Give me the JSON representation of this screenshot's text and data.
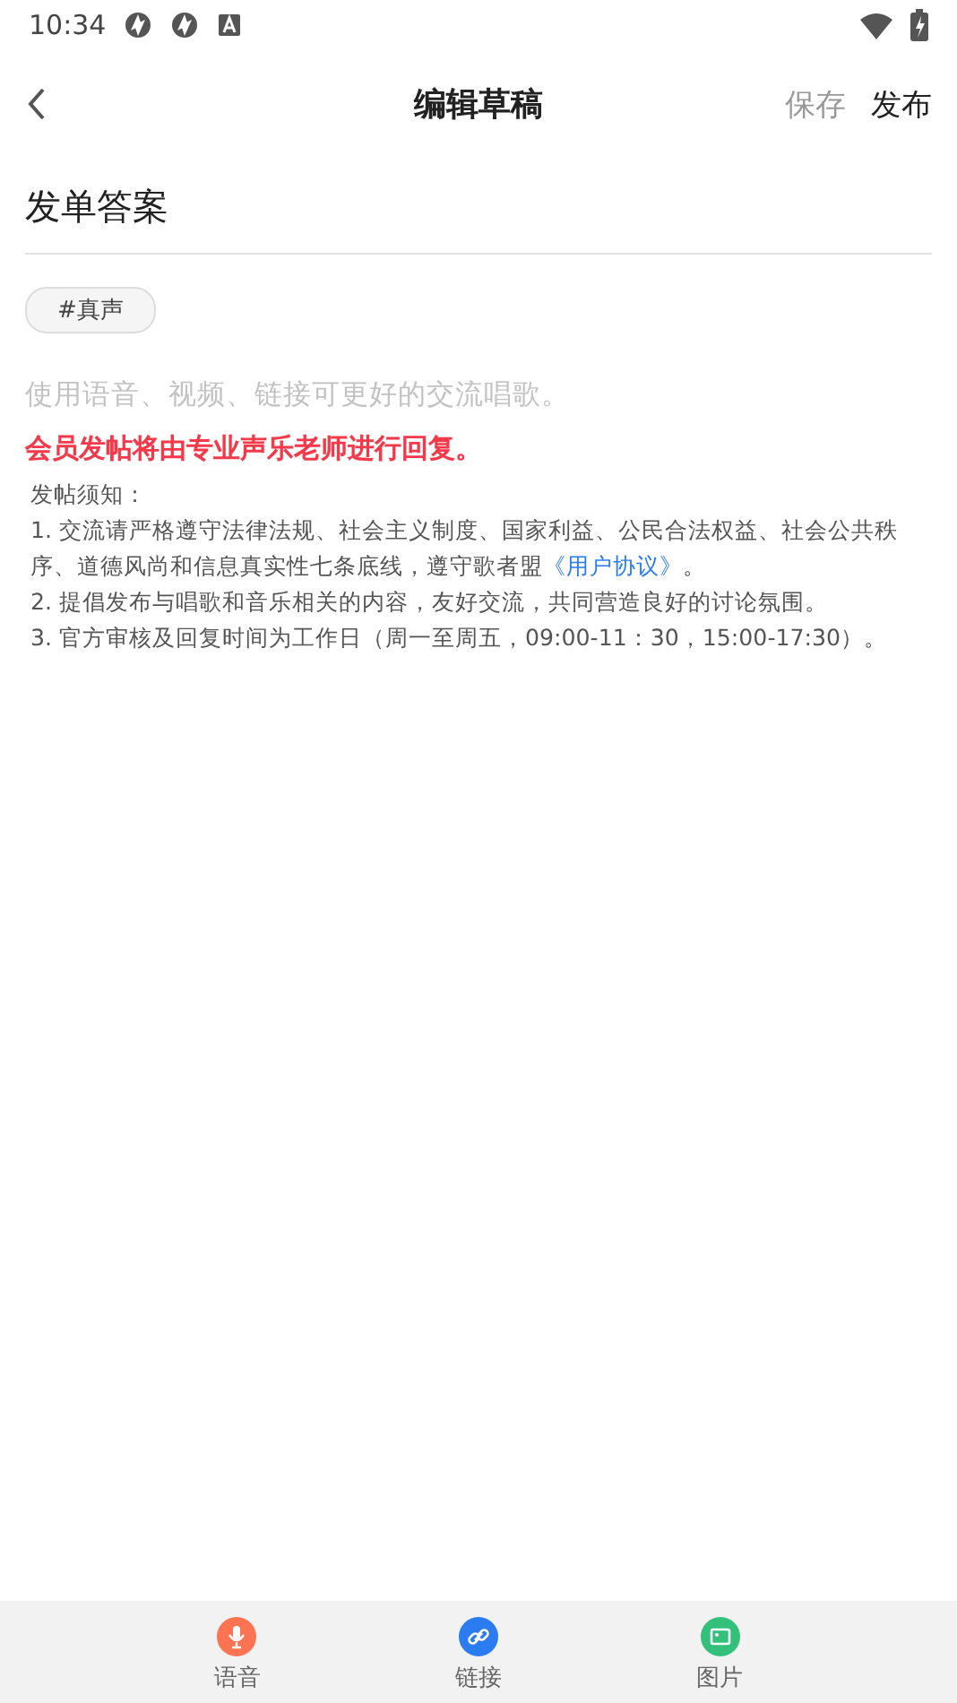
{
  "status_bar": {
    "time": "10:34"
  },
  "header": {
    "title": "编辑草稿",
    "actions": [
      {
        "label": "保存",
        "disabled": true
      },
      {
        "label": "发布",
        "disabled": false
      }
    ]
  },
  "post": {
    "title": "发单答案",
    "tags": [
      "#真声"
    ],
    "body_placeholder": "使用语音、视频、链接可更好的交流唱歌。",
    "member_notice": "会员发帖将由专业声乐老师进行回复。",
    "rules": {
      "heading": "发帖须知：",
      "items": [
        {
          "text": "1. 交流请严格遵守法律法规、社会主义制度、国家利益、公民合法权益、社会公共秩序、道德风尚和信息真实性七条底线，遵守歌者盟",
          "link": "《用户协议》",
          "after": "。"
        },
        {
          "text": "2. 提倡发布与唱歌和音乐相关的内容，友好交流，共同营造良好的讨论氛围。"
        },
        {
          "text": "3. 官方审核及回复时间为工作日（周一至周五，09:00-11：30，15:00-17:30）。"
        }
      ]
    }
  },
  "toolbar": [
    {
      "kind": "voice",
      "label": "语音",
      "color": "#fe7452"
    },
    {
      "kind": "link",
      "label": "链接",
      "color": "#2b7cf0"
    },
    {
      "kind": "image",
      "label": "图片",
      "color": "#33c07a"
    }
  ]
}
